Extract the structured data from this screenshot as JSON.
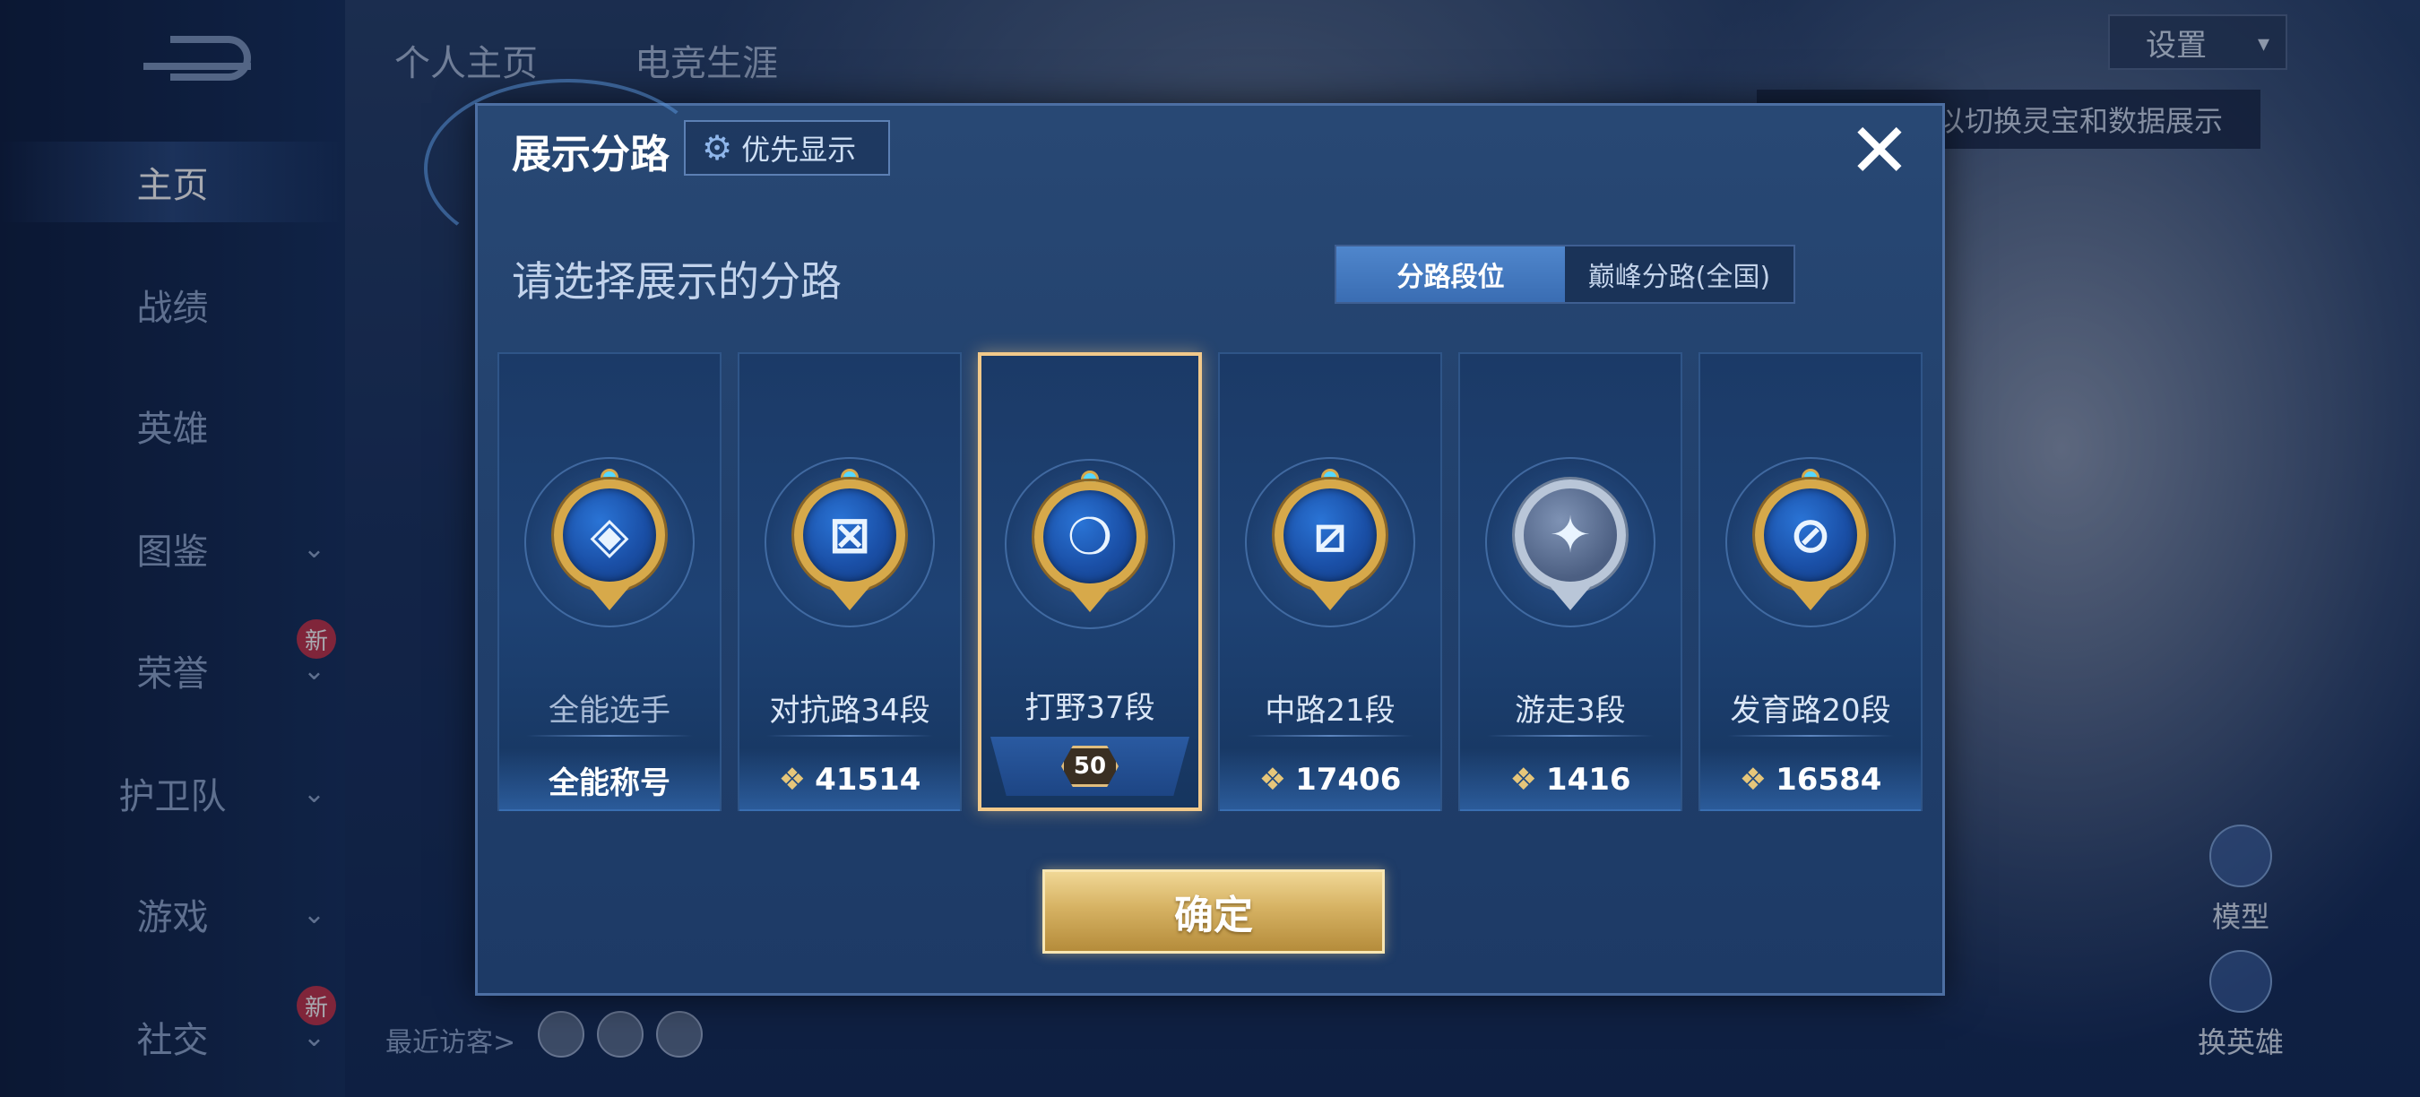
{
  "background": {
    "sidebar": {
      "items": [
        {
          "label": "主页",
          "active": true
        },
        {
          "label": "战绩"
        },
        {
          "label": "英雄"
        },
        {
          "label": "图鉴",
          "chevron": "chevron-down-icon"
        },
        {
          "label": "荣誉",
          "chevron": "chevron-down-icon",
          "badge": "新"
        },
        {
          "label": "护卫队",
          "chevron": "chevron-down-icon"
        },
        {
          "label": "游戏",
          "chevron": "chevron-down-icon"
        },
        {
          "label": "社交",
          "chevron": "chevron-down-icon",
          "badge": "新"
        }
      ]
    },
    "top_tabs": [
      "个人主页",
      "电竞生涯"
    ],
    "settings_label": "设置",
    "tip_text": "以切换灵宝和数据展示",
    "recent_visitors_label": "最近访客>",
    "right_actions": [
      {
        "label": "模型",
        "icon": "model-icon"
      },
      {
        "label": "换英雄",
        "icon": "switch-hero-icon"
      }
    ]
  },
  "modal": {
    "title": "展示分路",
    "priority_label": "优先显示",
    "subtitle": "请选择展示的分路",
    "segments": [
      {
        "label": "分路段位",
        "active": true
      },
      {
        "label": "巅峰分路(全国)",
        "active": false
      }
    ],
    "cards": [
      {
        "name": "全能选手",
        "footer": "全能称号",
        "emblem": "all-rounder-emblem-icon",
        "glyph": "◈",
        "metal": "gold"
      },
      {
        "name": "对抗路34段",
        "score": "41514",
        "emblem": "clash-lane-emblem-icon",
        "glyph": "⊠",
        "metal": "gold"
      },
      {
        "name": "打野37段",
        "level": "50",
        "emblem": "jungle-emblem-icon",
        "glyph": "❍",
        "metal": "gold",
        "selected": true
      },
      {
        "name": "中路21段",
        "score": "17406",
        "emblem": "mid-lane-emblem-icon",
        "glyph": "⧄",
        "metal": "gold"
      },
      {
        "name": "游走3段",
        "score": "1416",
        "emblem": "roam-emblem-icon",
        "glyph": "✦",
        "metal": "silver"
      },
      {
        "name": "发育路20段",
        "score": "16584",
        "emblem": "farm-lane-emblem-icon",
        "glyph": "⊘",
        "metal": "gold"
      }
    ],
    "confirm_label": "确定"
  }
}
